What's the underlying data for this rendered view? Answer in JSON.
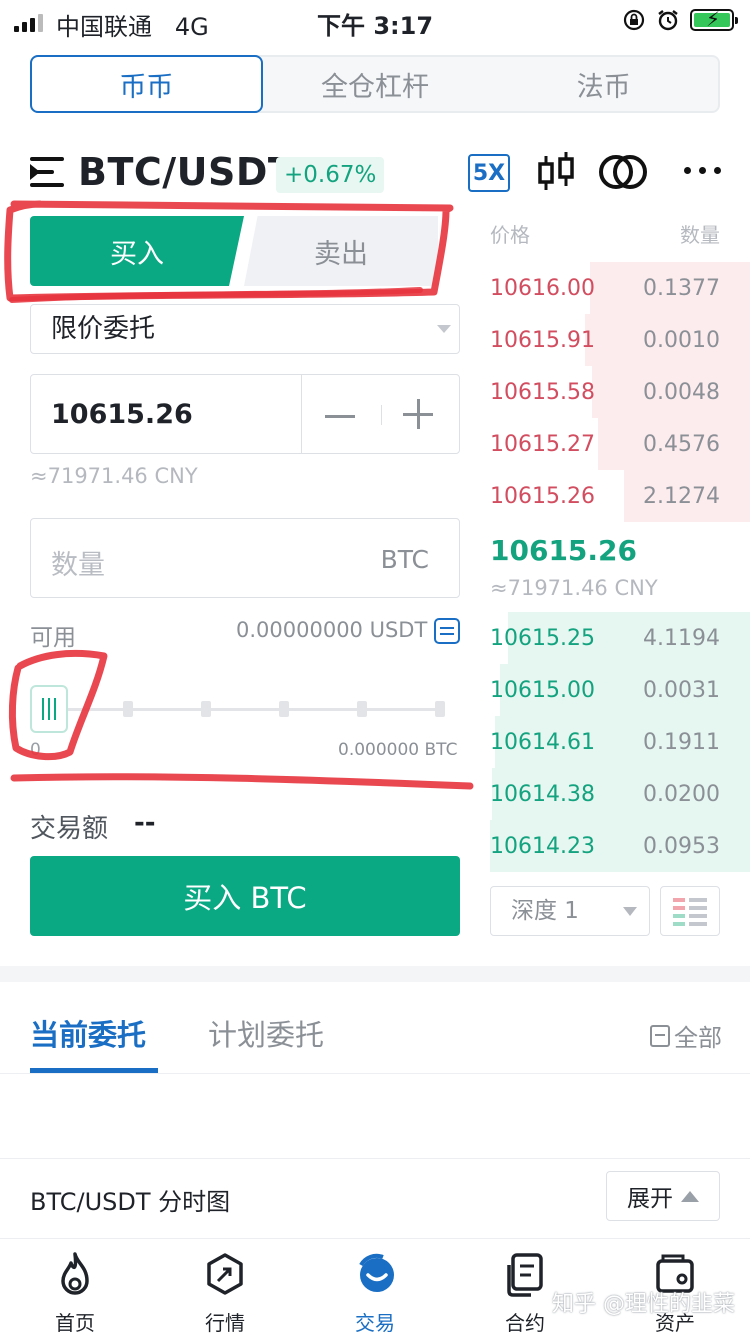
{
  "status_bar": {
    "carrier": "中国联通",
    "network": "4G",
    "time": "下午 3:17"
  },
  "mode_tabs": [
    {
      "label": "币币",
      "active": true
    },
    {
      "label": "全仓杠杆",
      "active": false
    },
    {
      "label": "法币",
      "active": false
    }
  ],
  "pair": {
    "name": "BTC/USDT",
    "change": "+0.67%",
    "leverage": "5X"
  },
  "trade_form": {
    "buy_label": "买入",
    "sell_label": "卖出",
    "order_type": "限价委托",
    "price": "10615.26",
    "price_cny": "≈71971.46 CNY",
    "quantity_placeholder": "数量",
    "quantity_unit": "BTC",
    "available_label": "可用",
    "available_value": "0.00000000 USDT",
    "slider_min": "0",
    "slider_max": "0.000000 BTC",
    "slider_percent": 0,
    "amount_label": "交易额",
    "amount_value": "--",
    "submit_label": "买入 BTC"
  },
  "order_book": {
    "price_header": "价格",
    "qty_header": "数量",
    "asks": [
      {
        "price": "10616.00",
        "qty": "0.1377"
      },
      {
        "price": "10615.91",
        "qty": "0.0010"
      },
      {
        "price": "10615.58",
        "qty": "0.0048"
      },
      {
        "price": "10615.27",
        "qty": "0.4576"
      },
      {
        "price": "10615.26",
        "qty": "2.1274"
      }
    ],
    "last_price": "10615.26",
    "last_price_cny": "≈71971.46 CNY",
    "bids": [
      {
        "price": "10615.25",
        "qty": "4.1194"
      },
      {
        "price": "10615.00",
        "qty": "0.0031"
      },
      {
        "price": "10614.61",
        "qty": "0.1911"
      },
      {
        "price": "10614.38",
        "qty": "0.0200"
      },
      {
        "price": "10614.23",
        "qty": "0.0953"
      }
    ],
    "depth_label": "深度 1"
  },
  "orders": {
    "tab_current": "当前委托",
    "tab_plan": "计划委托",
    "all_label": "全部"
  },
  "chart_panel": {
    "title": "BTC/USDT 分时图",
    "expand_label": "展开"
  },
  "bottom_nav": [
    {
      "label": "首页",
      "icon": "flame-icon"
    },
    {
      "label": "行情",
      "icon": "market-icon"
    },
    {
      "label": "交易",
      "icon": "trade-icon",
      "active": true
    },
    {
      "label": "合约",
      "icon": "contract-icon"
    },
    {
      "label": "资产",
      "icon": "wallet-icon"
    }
  ],
  "watermark": "知乎 @理性的韭菜",
  "colors": {
    "accent_blue": "#1a6fc4",
    "buy_green": "#0aa984",
    "ask_red": "#d24d5f",
    "annotation_red": "#e8343d"
  }
}
